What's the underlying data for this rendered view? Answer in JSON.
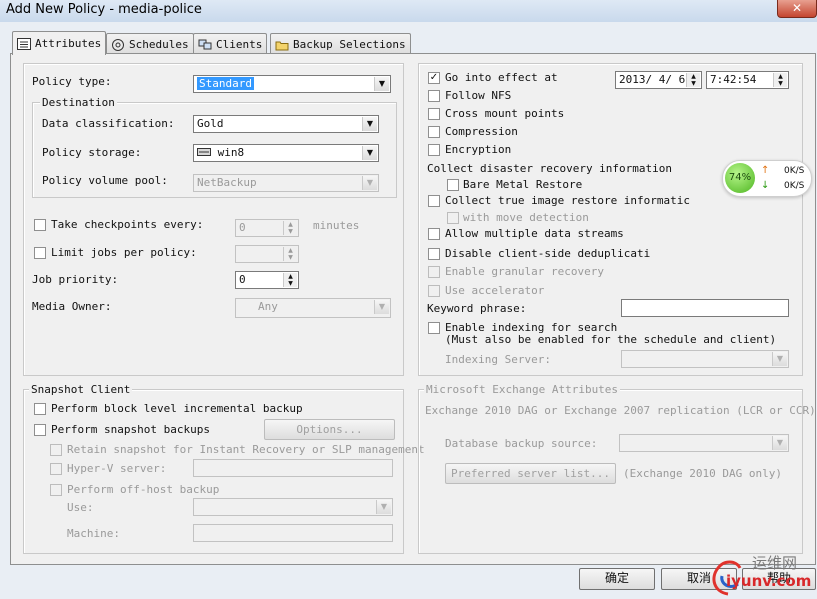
{
  "window": {
    "title": "Add New Policy - media-police",
    "close_glyph": "✕"
  },
  "tabs": [
    {
      "label": "Attributes",
      "icon": "attributes-icon",
      "active": true
    },
    {
      "label": "Schedules",
      "icon": "schedules-icon"
    },
    {
      "label": "Clients",
      "icon": "clients-icon"
    },
    {
      "label": "Backup Selections",
      "icon": "backup-selections-icon"
    }
  ],
  "left": {
    "policy_type_label": "Policy type:",
    "policy_type_value": "Standard",
    "destination_legend": "Destination",
    "data_classification_label": "Data classification:",
    "data_classification_value": "Gold",
    "policy_storage_label": "Policy storage:",
    "policy_storage_value": "win8",
    "policy_volume_pool_label": "Policy volume pool:",
    "policy_volume_pool_value": "NetBackup",
    "take_checkpoints_label": "Take checkpoints every:",
    "take_checkpoints_value": "0",
    "minutes_label": "minutes",
    "limit_jobs_label": "Limit jobs per policy:",
    "limit_jobs_value": "",
    "job_priority_label": "Job priority:",
    "job_priority_value": "0",
    "media_owner_label": "Media Owner:",
    "media_owner_value": "Any"
  },
  "snapshot": {
    "legend": "Snapshot Client",
    "block_level_label": "Perform block level incremental backup",
    "perform_snapshot_label": "Perform snapshot backups",
    "options_button": "Options...",
    "retain_snapshot_label": "Retain snapshot for Instant Recovery or SLP management",
    "hyperv_label": "Hyper-V server:",
    "offhost_label": "Perform off-host backup",
    "use_label": "Use:",
    "machine_label": "Machine:"
  },
  "right": {
    "go_into_effect_label": "Go into effect at",
    "go_into_effect_checked": true,
    "date_value": "2013/ 4/ 6",
    "time_value": "7:42:54",
    "follow_nfs_label": "Follow NFS",
    "cross_mount_label": "Cross mount points",
    "compression_label": "Compression",
    "encryption_label": "Encryption",
    "collect_dr_label": "Collect disaster recovery information",
    "bare_metal_label": "Bare Metal Restore",
    "collect_true_image_label": "Collect true image restore informatic",
    "move_detection_label": "with move detection",
    "allow_multiple_label": "Allow multiple data streams",
    "disable_dedup_label": "Disable client-side deduplicati",
    "granular_label": "Enable granular recovery",
    "accelerator_label": "Use accelerator",
    "keyword_label": "Keyword phrase:",
    "keyword_value": "",
    "enable_indexing_label": "Enable indexing for search",
    "indexing_note": "(Must also be enabled for the schedule and client)",
    "indexing_server_label": "Indexing Server:"
  },
  "exchange": {
    "legend": "Microsoft Exchange Attributes",
    "desc": "Exchange 2010 DAG or Exchange 2007 replication (LCR or CCR)",
    "db_source_label": "Database backup source:",
    "preferred_button": "Preferred server list...",
    "preferred_note": "(Exchange 2010 DAG only)"
  },
  "footer": {
    "ok_label": "确定",
    "cancel_label": "取消",
    "help_label": "帮助"
  },
  "net_badge": {
    "percent": "74%",
    "up": "0K/S",
    "down": "0K/S",
    "up_arrow": "↑",
    "down_arrow": "↓"
  },
  "watermark": {
    "text": "运维网",
    "sub": "iyunv.com"
  },
  "colors": {
    "selection": "#3399ff",
    "dialog_bg": "#f0f0f0",
    "badge_green": "#4db520",
    "watermark_red": "#e0322c"
  }
}
